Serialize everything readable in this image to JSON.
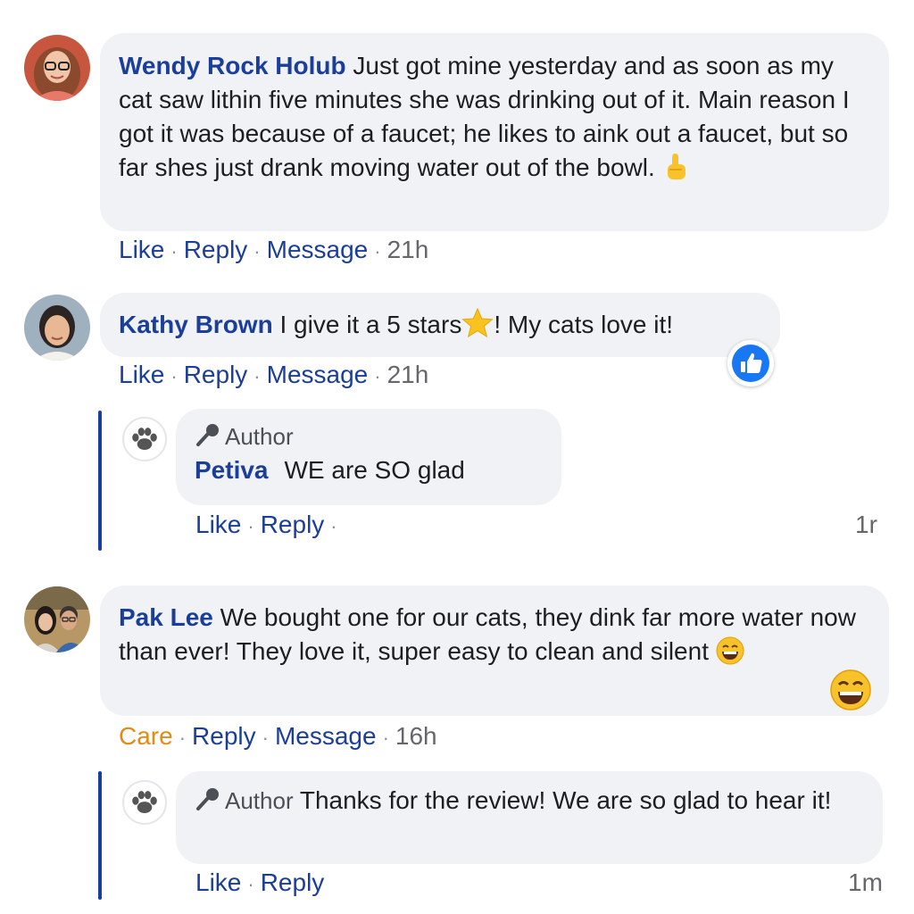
{
  "comments": [
    {
      "author": "Wendy Rock Holub",
      "text": "Just got mine yesterday and as soon as my cat saw lithin five minutes she was drinking out of it. Main reason I got it was because of a faucet; he likes to aink out a faucet, but so far shes just drank moving water out of the bowl.",
      "emoji": "pointing-up-hand-icon",
      "actions": [
        "Like",
        "Reply",
        "Message"
      ],
      "time": "21h"
    },
    {
      "author": "Kathy Brown",
      "text_before": "I give it a 5 stars",
      "text_after": "! My cats love it!",
      "emoji": "star-icon",
      "actions": [
        "Like",
        "Reply",
        "Message"
      ],
      "time": "21h",
      "reaction": "like-icon",
      "reply": {
        "tag": "Author",
        "author": "Petiva",
        "text": "WE are SO glad",
        "actions": [
          "Like",
          "Reply"
        ],
        "time": "1r"
      }
    },
    {
      "author": "Pak Lee",
      "text": "We bought one for our cats, they dink far more water now than ever! They love it, super easy to clean and silent",
      "emoji": "grinning-face-icon",
      "actions": [
        "Care",
        "Reply",
        "Message"
      ],
      "time": "16h",
      "reaction": "grinning-face-icon",
      "reply": {
        "tag": "Author",
        "text": "Thanks for the review! We are so glad to hear it!",
        "actions": [
          "Like",
          "Reply"
        ],
        "time": "1m"
      }
    }
  ],
  "colors": {
    "name": "#1a3e9a",
    "bubble": "#f0f2f5",
    "care": "#e58a15",
    "thread": "#1a3ea0",
    "like_badge": "#1877f2"
  }
}
